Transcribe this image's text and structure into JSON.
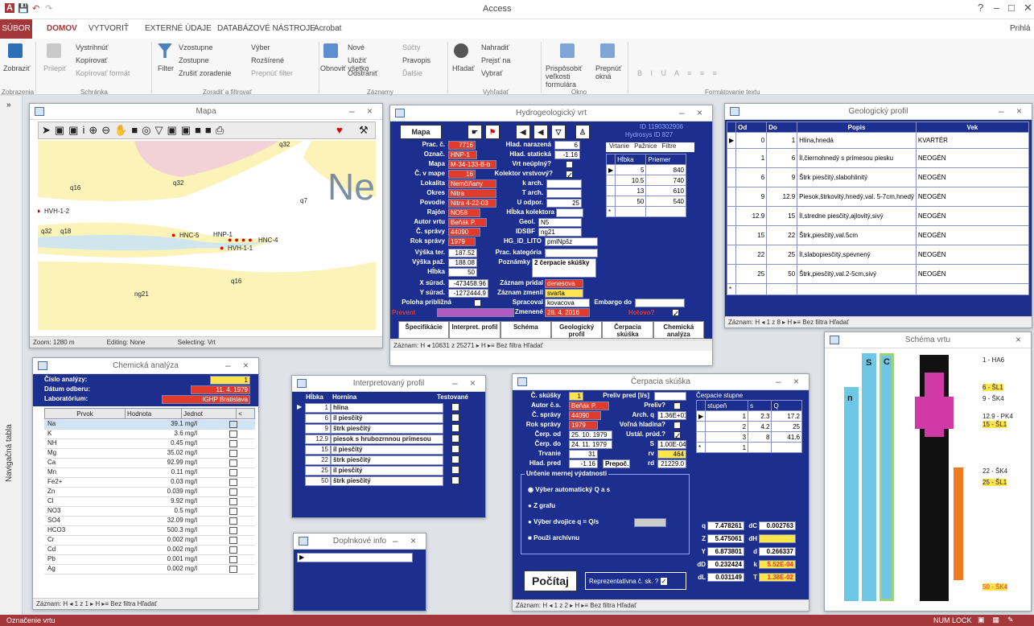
{
  "app": {
    "title": "Access",
    "status_left": "Označenie vrtu",
    "status_right": "NUM LOCK",
    "signin": "Prihlá"
  },
  "ribbon": {
    "tabs": [
      "SÚBOR",
      "DOMOV",
      "VYTVORIŤ",
      "EXTERNÉ ÚDAJE",
      "DATABÁZOVÉ NÁSTROJE",
      "Acrobat"
    ],
    "views": "Zobraziť",
    "clipboard": [
      "Vystrihnúť",
      "Kopírovať",
      "Kopírovať formát",
      "Prilepiť"
    ],
    "sort": [
      "Vzostupne",
      "Zostupne",
      "Zrušiť zoradenie",
      "Filter",
      "Výber",
      "Rozšírené",
      "Prepnúť filter"
    ],
    "records": [
      "Obnoviť všetko",
      "Nové",
      "Uložiť",
      "Odstrániť",
      "Súčty",
      "Pravopis",
      "Ďalšie"
    ],
    "find": [
      "Hľadať",
      "Nahradiť",
      "Prejsť na",
      "Vybrať"
    ],
    "window": [
      "Prispôsobiť veľkosti formulára",
      "Prepnúť okná"
    ],
    "groups": [
      "Zobrazenia",
      "Schránka",
      "Zoradiť a filtrovať",
      "Záznamy",
      "Vyhľadať",
      "Okno",
      "Formátovanie textu"
    ]
  },
  "nav": {
    "label": "Navigačná tabla"
  },
  "map": {
    "title": "Mapa",
    "labels": [
      "q32",
      "q16",
      "q32",
      "q7",
      "q32",
      "q18",
      "q16",
      "ng21",
      "HVH-1-2",
      "HNC-5",
      "HNP-1",
      "HNC-4",
      "HVH-1-1",
      "Ne"
    ],
    "status": [
      "Zoom: 1280 m",
      "Editing: None",
      "Selecting: Vrt"
    ]
  },
  "well": {
    "title": "Hydrogeologický vrt",
    "id_label": "ID",
    "id_value": "1190302906",
    "hydroid_label": "Hydrosys ID",
    "hydroid_value": "827",
    "btn_map": "Mapa",
    "fields": {
      "prac_c": "7716",
      "oznac": "HNP-1",
      "mapa": "M-34-133-B-b",
      "c_v_mape": "16",
      "lokalita": "Nemčiňany",
      "okres": "Nitra",
      "povodie": "Nitra 4-22-03",
      "rajon": "NO58",
      "autor": "Beňák P.",
      "c_spravy": "44090",
      "rok_spravy": "1979",
      "vyska_ter": "187.52",
      "vyska_paz": "188.08",
      "hlbka": "50",
      "x_surad": "-473458.96",
      "y_surad": "-1272444.9",
      "hlad_narazena": "6",
      "hlad_staticka": "-1.16",
      "u_odpor": "25",
      "geol": "N5",
      "idsbf": "ng21",
      "hg_id_lito": "pmlNpšz",
      "poznamky": "2 čerpacie skúšky",
      "zaznam_pridal": "denesova",
      "zaznam_zmenil": "svarta",
      "spracoval": "kovacova",
      "zmenene": "28. 4. 2016"
    },
    "labels": {
      "prac_c": "Prac. č.",
      "oznac": "Označ.",
      "mapa": "Mapa",
      "c_v_mape": "Č. v mape",
      "lokalita": "Lokalita",
      "okres": "Okres",
      "povodie": "Povodie",
      "rajon": "Rajón",
      "autor": "Autor vrtu",
      "c_spravy": "Č. správy",
      "rok_spravy": "Rok správy",
      "vyska_ter": "Výška ter.",
      "vyska_paz": "Výška paž.",
      "hlbka": "Hĺbka",
      "x_surad": "X súrad.",
      "y_surad": "Y súrad.",
      "poloha": "Poloha približná",
      "prevent": "Prevent",
      "hlad_narazena": "Hlad. narazená",
      "hlad_staticka": "Hlad. statická",
      "vrt_neuplny": "Vrt neúplný?",
      "kolektor": "Kolektor vrstvový?",
      "k_arch": "k arch.",
      "t_arch": "T arch.",
      "u_odpor": "U odpor.",
      "hlbka_kolektora": "Hĺbka kolektora",
      "geol": "Geol.",
      "idsbf": "IDSBF",
      "hg_id_lito": "HG_ID_LITO",
      "prac_kategoria": "Prac. kategória",
      "poznamky": "Poznámky",
      "zaznam_pridal": "Záznam pridal",
      "zaznam_zmenil": "Záznam zmenil",
      "spracoval": "Spracoval",
      "embargo": "Embargo do",
      "zmenene": "Zmenené",
      "hotovo": "Hotovo?"
    },
    "tabs": [
      "Vrtanie",
      "Pažnice",
      "Filtre"
    ],
    "vrt_cols": [
      "Hĺbka",
      "Priemer"
    ],
    "vrt_rows": [
      [
        "5",
        "840"
      ],
      [
        "10.5",
        "740"
      ],
      [
        "13",
        "610"
      ],
      [
        "50",
        "540"
      ]
    ],
    "bottom_tabs": [
      "Špecifikácie",
      "Interpret. profil",
      "Schéma",
      "Geologický profil",
      "Čerpacia skúška",
      "Chemická analýza"
    ],
    "nav": "Záznam: H ◂ 10631 z 25271 ▸ H ▸≡ Bez filtra Hľadať"
  },
  "geo": {
    "title": "Geologický profil",
    "cols": [
      "Od",
      "Do",
      "Popis",
      "Vek"
    ],
    "rows": [
      [
        "0",
        "1",
        "Hlina,hnedá",
        "KVARTÉR"
      ],
      [
        "1",
        "6",
        "Íl,čiernohnedý s prímesou piesku",
        "NEOGÉN"
      ],
      [
        "6",
        "9",
        "Štrk piesčitý,slabohlinitý",
        "NEOGÉN"
      ],
      [
        "9",
        "12.9",
        "Piesok,štrkovitý,hnedý,val. 5-7cm,hnedý",
        "NEOGÉN"
      ],
      [
        "12.9",
        "15",
        "Íl,stredne piesčitý,ajlovitý,sivý",
        "NEOGÉN"
      ],
      [
        "15",
        "22",
        "Štrk,piesčitý,val.5cm",
        "NEOGÉN"
      ],
      [
        "22",
        "25",
        "Íl,slabopiesčitý,spevnený",
        "NEOGÉN"
      ],
      [
        "25",
        "50",
        "Štrk,piesčitý,val.2-5cm,sivý",
        "NEOGÉN"
      ]
    ],
    "nav": "Záznam: H ◂ 1 z 8 ▸ H ▸≡ Bez filtra Hľadať"
  },
  "chem": {
    "title": "Chemická analýza",
    "labels": [
      "Číslo analýzy:",
      "Dátum odberu:",
      "Laboratórium:"
    ],
    "values": [
      "1",
      "11. 4. 1979",
      "IGHP Bratislava"
    ],
    "cols": [
      "Prvok",
      "Hodnota",
      "Jednot",
      "<"
    ],
    "rows": [
      [
        "Na",
        "39.1 mg/l"
      ],
      [
        "K",
        "3.6 mg/l"
      ],
      [
        "NH",
        "0.45 mg/l"
      ],
      [
        "Mg",
        "35.02 mg/l"
      ],
      [
        "Ca",
        "92.99 mg/l"
      ],
      [
        "Mn",
        "0.11 mg/l"
      ],
      [
        "Fe2+",
        "0.03 mg/l"
      ],
      [
        "Zn",
        "0.039 mg/l"
      ],
      [
        "Cl",
        "9.92 mg/l"
      ],
      [
        "NO3",
        "0.5 mg/l"
      ],
      [
        "SO4",
        "32.09 mg/l"
      ],
      [
        "HCO3",
        "500.3 mg/l"
      ],
      [
        "Cr",
        "0.002 mg/l"
      ],
      [
        "Cd",
        "0.002 mg/l"
      ],
      [
        "Pb",
        "0.001 mg/l"
      ],
      [
        "Ag",
        "0.002 mg/l"
      ]
    ],
    "nav": "Záznam: H ◂ 1 z 1 ▸ H ▸≡ Bez filtra Hľadať"
  },
  "interp": {
    "title": "Interpretovaný profil",
    "cols": [
      "Hĺbka",
      "Hornina",
      "Testované"
    ],
    "rows": [
      [
        "1",
        "hlina"
      ],
      [
        "6",
        "íl piesčitý"
      ],
      [
        "9",
        "štrk piesčitý"
      ],
      [
        "12.9",
        "piesok s hrubozrnnou prímesou"
      ],
      [
        "15",
        "íl piesčitý"
      ],
      [
        "22",
        "štrk piesčitý"
      ],
      [
        "25",
        "íl piesčitý"
      ],
      [
        "50",
        "štrk piesčitý"
      ]
    ]
  },
  "small": {
    "title": "Doplnkové info"
  },
  "pump": {
    "title": "Čerpacia skúška",
    "labels": {
      "c_skusky": "Č. skúšky",
      "preliv": "Preliv pred [l/s]",
      "autor": "Autor č.s.",
      "prelivq": "Preliv?",
      "c_spravy": "Č. správy",
      "arch_q": "Arch. q",
      "rok": "Rok správy",
      "volna": "Voľná hladina?",
      "cerp_od": "Čerp. od",
      "ustal": "Ustál. prúd.?",
      "cerp_do": "Čerp. do",
      "s": "S",
      "trvanie": "Trvanie",
      "rv": "rv",
      "hlad": "Hlad. pred",
      "prepoc": "Prepoč.",
      "rd": "rd"
    },
    "values": {
      "c_skusky": "1",
      "autor": "Beňák P.",
      "c_spravy": "44090",
      "arch_q": "1.36E+01",
      "rok": "1979",
      "cerp_od": "25. 10. 1979",
      "cerp_do": "24. 11. 1979",
      "s": "1.00E-04",
      "trvanie": "31",
      "rv": "464",
      "hlad": "-1.16",
      "rd": "21229.0"
    },
    "stupne_title": "Čerpacie stupne",
    "stupne_cols": [
      "stupeň",
      "s",
      "Q"
    ],
    "stupne_rows": [
      [
        "1",
        "2.3",
        "17.2"
      ],
      [
        "2",
        "4.2",
        "25"
      ],
      [
        "3",
        "8",
        "41.6"
      ],
      [
        "1",
        "",
        ""
      ]
    ],
    "urcenie": "Určenie mernej výdatnosti",
    "radios": [
      "Výber automatický Q a s",
      "Z grafu",
      "Výber dvojice q = Q/s",
      "Použi archívnu"
    ],
    "calc": "Počítaj",
    "reprezent": "Reprezentatívna č. sk. ?",
    "res_left": [
      [
        "q",
        "7.478261"
      ],
      [
        "Z",
        "5.475061"
      ],
      [
        "Y",
        "6.873801"
      ],
      [
        "dD",
        "0.232424"
      ],
      [
        "dL",
        "0.031149"
      ]
    ],
    "res_right": [
      [
        "dC",
        "0.002763"
      ],
      [
        "dH",
        ""
      ],
      [
        "d",
        "0.266337"
      ],
      [
        "k",
        "5.52E-04"
      ],
      [
        "T",
        "1.38E-02"
      ]
    ],
    "nav": "Záznam: H ◂ 1 z 2 ▸ H ▸≡ Bez filtra Hľadať"
  },
  "schema": {
    "title": "Schéma vrtu",
    "col_labels": [
      "n",
      "S",
      "C"
    ],
    "labels": [
      "1 - HA6",
      "6 - ŠL1",
      "9 - ŠK4",
      "12.9 - PK4",
      "15 - ŠL1",
      "22 - ŠK4",
      "25 - ŠL1",
      "50 - ŠK4"
    ]
  },
  "colors": {
    "accent": "#a4373a",
    "form_blue": "#1c2f8f",
    "field_red": "#e23b2b",
    "field_yellow": "#ffe44d"
  }
}
